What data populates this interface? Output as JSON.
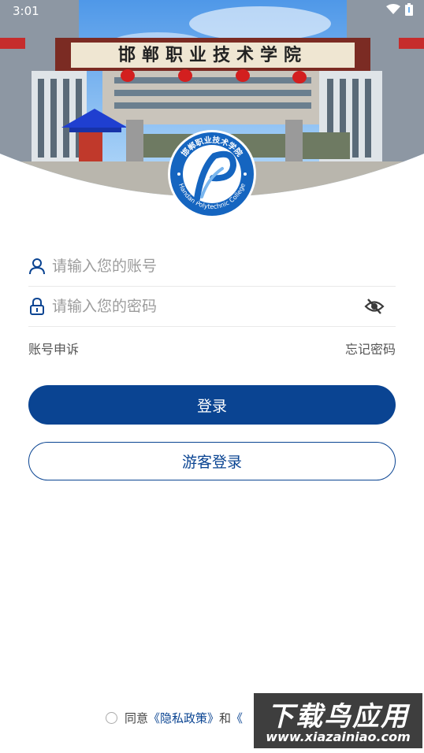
{
  "status_bar": {
    "time": "3:01"
  },
  "hero": {
    "gate_sign": "邯郸职业技术学院",
    "logo": {
      "name": "邯郸职业技术学院",
      "english": "Handan Polytechnic College"
    }
  },
  "form": {
    "account_placeholder": "请输入您的账号",
    "password_placeholder": "请输入您的密码",
    "appeal_label": "账号申诉",
    "forgot_label": "忘记密码"
  },
  "buttons": {
    "login": "登录",
    "guest_login": "游客登录"
  },
  "agreement": {
    "prefix": "同意",
    "privacy_link": "《隐私政策》",
    "conjunction": "和",
    "trailing": "《"
  },
  "watermark": {
    "title": "下载鸟应用",
    "url": "www.xiazainiao.com"
  },
  "colors": {
    "primary": "#0a4492",
    "sky": "#6fb2f0",
    "border": "#e9e9e9"
  }
}
